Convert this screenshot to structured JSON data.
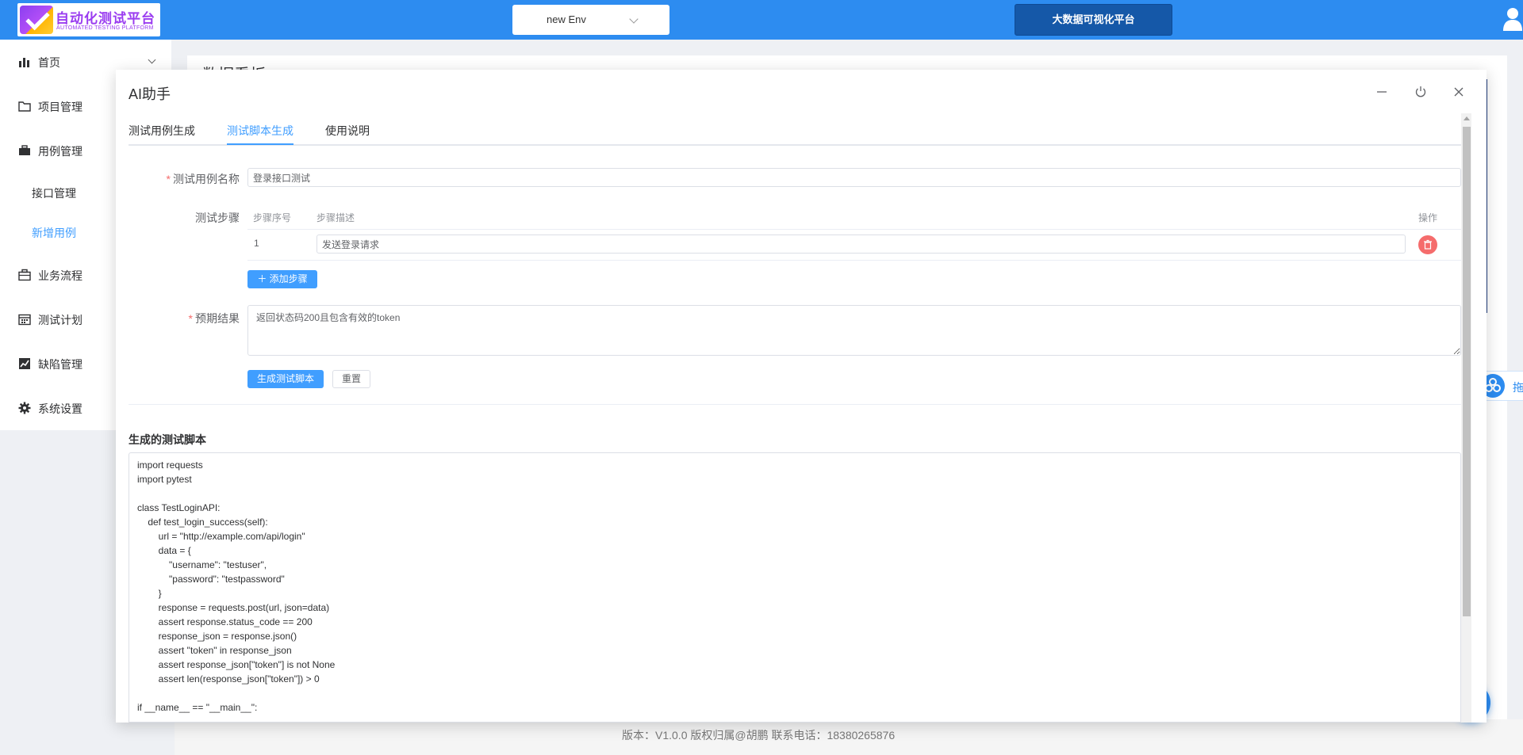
{
  "header": {
    "logo_title": "自动化测试平台",
    "logo_subtitle": "AUTOMATED TESTING PLATFORM",
    "env_select_value": "new Env",
    "bigdata_button": "大数据可视化平台"
  },
  "sidebar": {
    "items": [
      {
        "label": "首页",
        "icon": "bar-chart-icon"
      },
      {
        "label": "项目管理",
        "icon": "folder-icon"
      },
      {
        "label": "用例管理",
        "icon": "briefcase-icon"
      },
      {
        "label": "接口管理"
      },
      {
        "label": "新增用例",
        "active": true
      },
      {
        "label": "业务流程",
        "icon": "suitcase-icon"
      },
      {
        "label": "测试计划",
        "icon": "calendar-icon"
      },
      {
        "label": "缺陷管理",
        "icon": "trend-chart-icon"
      },
      {
        "label": "系统设置",
        "icon": "gear-icon"
      }
    ]
  },
  "main": {
    "title": "数据看板",
    "footer": "版本：V1.0.0 版权归属@胡鹏 联系电话：18380265876"
  },
  "float_widget": {
    "text": "拖"
  },
  "dialog": {
    "title": "AI助手",
    "tabs": [
      {
        "label": "测试用例生成"
      },
      {
        "label": "测试脚本生成",
        "active": true
      },
      {
        "label": "使用说明"
      }
    ],
    "form": {
      "case_name_label": "测试用例名称",
      "case_name_value": "登录接口测试",
      "steps_label": "测试步骤",
      "steps_columns": {
        "index": "步骤序号",
        "desc": "步骤描述",
        "action": "操作"
      },
      "steps": [
        {
          "index": "1",
          "desc": "发送登录请求"
        }
      ],
      "add_step_button": "添加步骤",
      "expected_label": "预期结果",
      "expected_value": "返回状态码200且包含有效的token",
      "generate_button": "生成测试脚本",
      "reset_button": "重置"
    },
    "script_section_title": "生成的测试脚本",
    "script_code": "import requests\nimport pytest\n\nclass TestLoginAPI:\n    def test_login_success(self):\n        url = \"http://example.com/api/login\"\n        data = {\n            \"username\": \"testuser\",\n            \"password\": \"testpassword\"\n        }\n        response = requests.post(url, json=data)\n        assert response.status_code == 200\n        response_json = response.json()\n        assert \"token\" in response_json\n        assert response_json[\"token\"] is not None\n        assert len(response_json[\"token\"]) > 0\n\nif __name__ == \"__main__\":"
  },
  "colors": {
    "header_bg": "#2d8cf0",
    "accent": "#409eff",
    "danger": "#f56c6c",
    "bigdata_button_bg": "#1558a8"
  }
}
